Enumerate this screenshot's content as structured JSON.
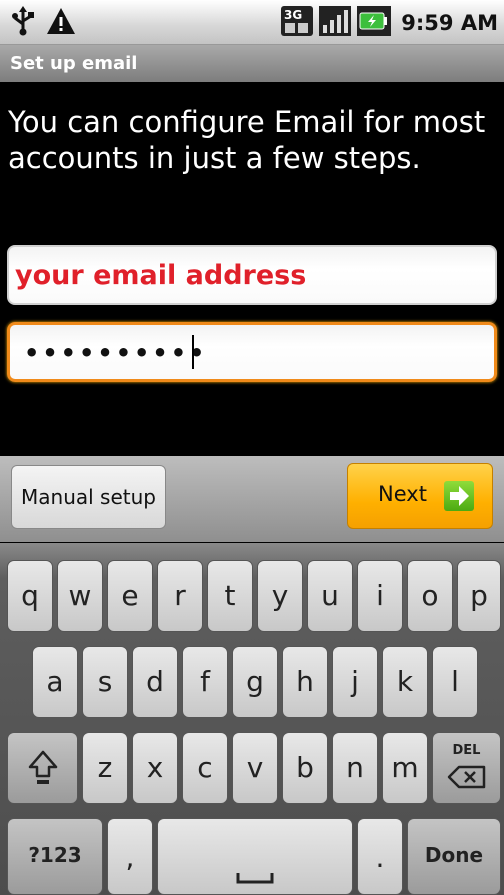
{
  "status_bar": {
    "icons": [
      "usb-icon",
      "warning-icon",
      "3g-icon",
      "signal-icon",
      "battery-icon"
    ],
    "network_label": "3G",
    "time": "9:59 AM"
  },
  "title": "Set up email",
  "intro": "You can configure Email for most accounts in just a few steps.",
  "email_field": {
    "value": "your email address"
  },
  "password_field": {
    "value": "••••••••••"
  },
  "buttons": {
    "manual": "Manual setup",
    "next": "Next"
  },
  "keyboard": {
    "row1": [
      "q",
      "w",
      "e",
      "r",
      "t",
      "y",
      "u",
      "i",
      "o",
      "p"
    ],
    "row2": [
      "a",
      "s",
      "d",
      "f",
      "g",
      "h",
      "j",
      "k",
      "l"
    ],
    "row3": [
      "z",
      "x",
      "c",
      "v",
      "b",
      "n",
      "m"
    ],
    "del_label": "DEL",
    "mode_key": "?123",
    "comma": ",",
    "period": ".",
    "done": "Done"
  },
  "colors": {
    "accent_orange": "#f08a1a",
    "next_button": "#ffb000",
    "email_text": "#e0202a",
    "next_arrow": "#5cb81a"
  }
}
